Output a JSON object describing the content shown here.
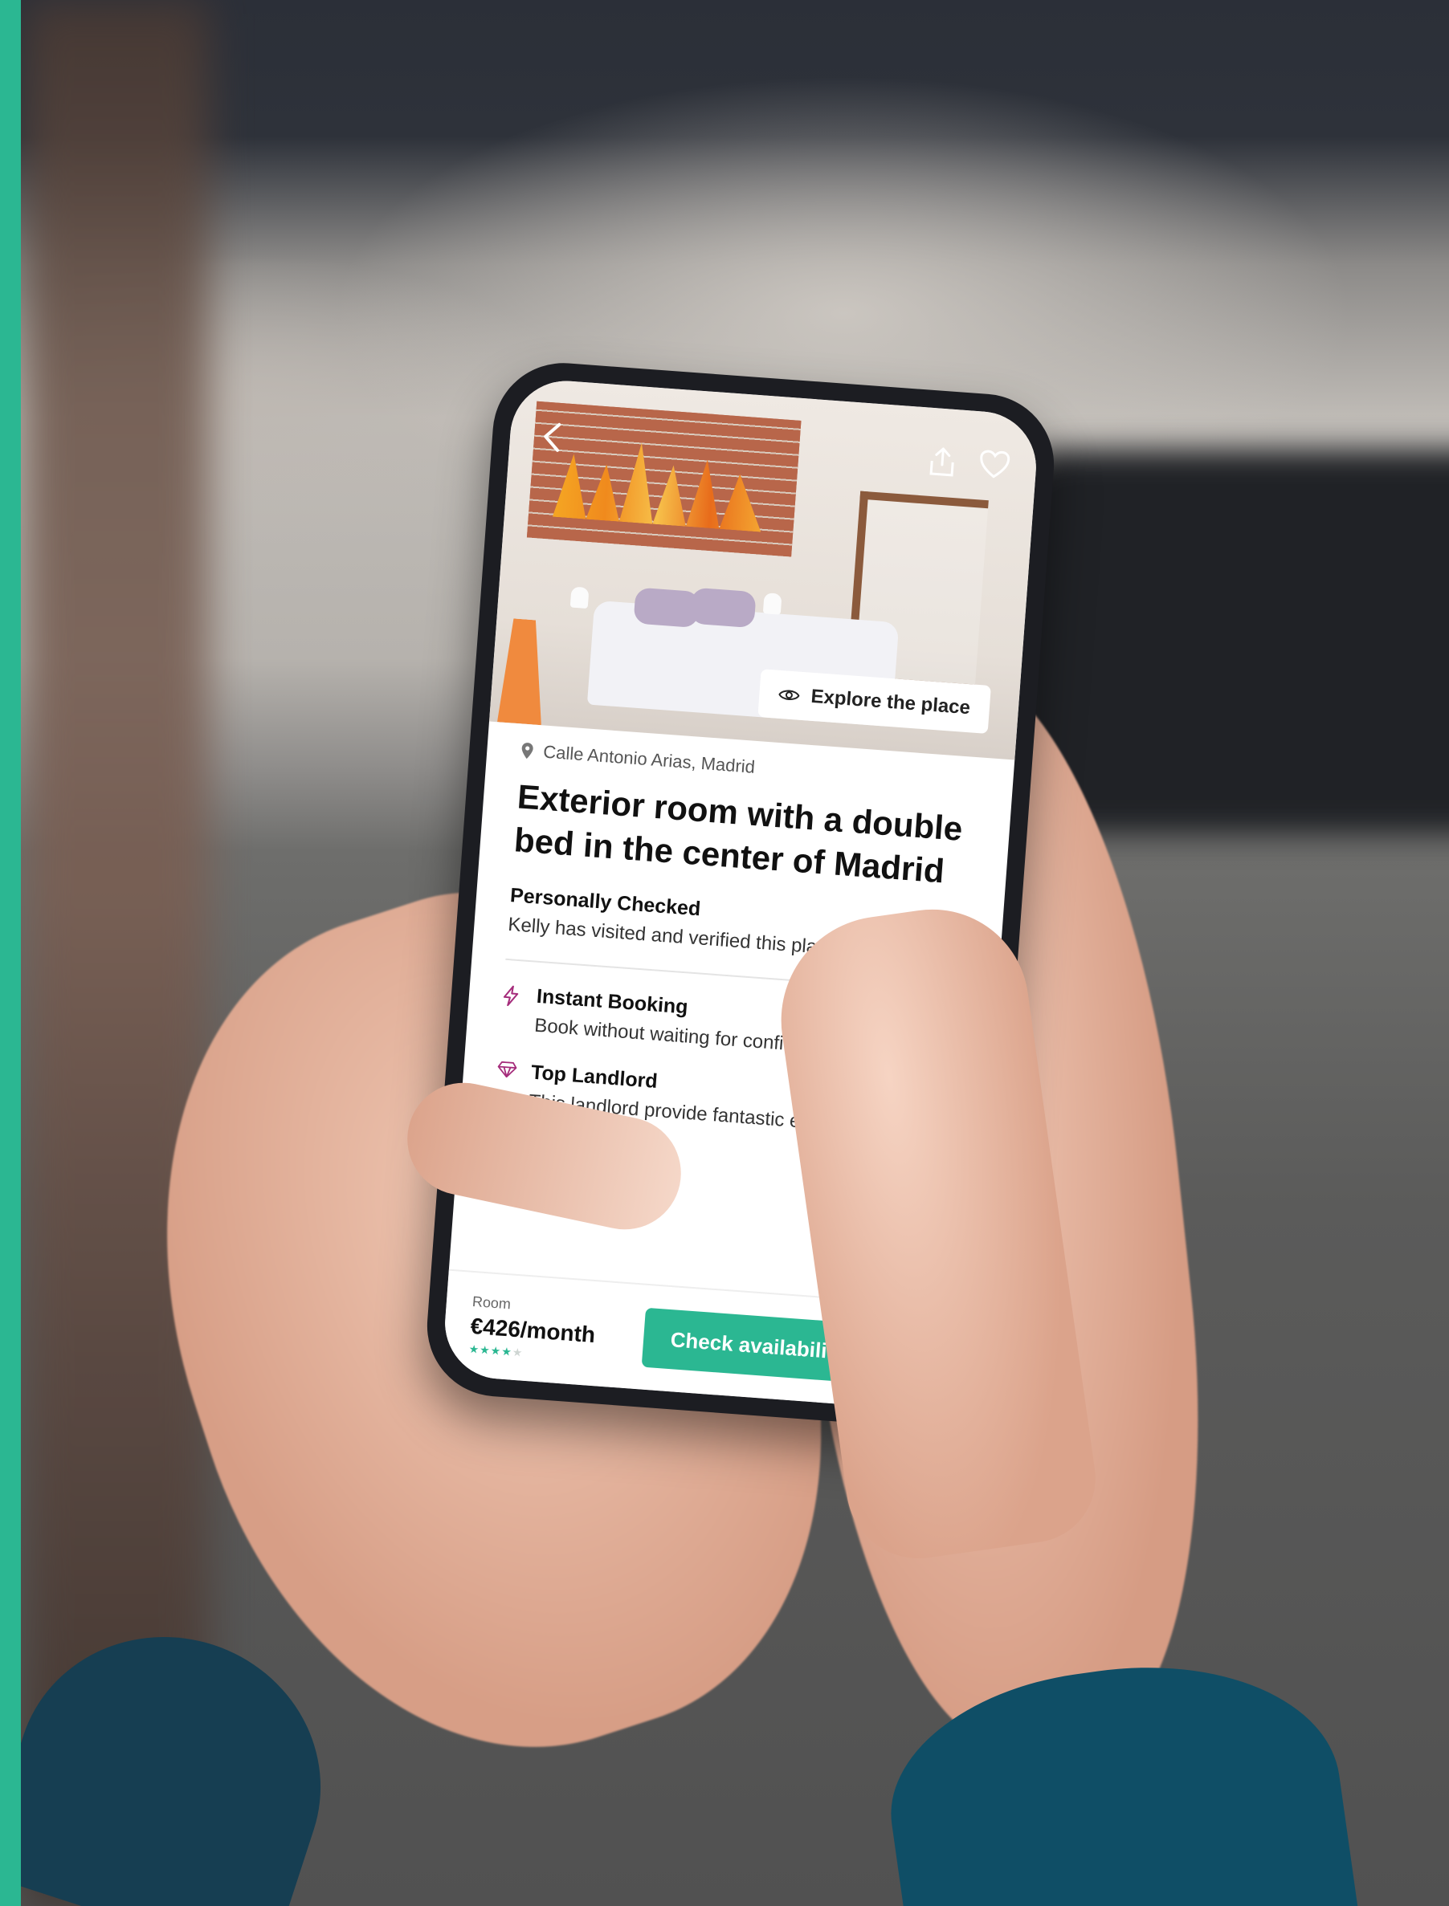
{
  "colors": {
    "accent": "#2bb792",
    "pin_icon": "#777777",
    "diamond_icon": "#a52c7b"
  },
  "listing": {
    "explore_label": "Explore the place",
    "address": "Calle Antonio Arias, Madrid",
    "title": "Exterior room with a double bed in the center of Madrid",
    "features": [
      {
        "icon": "checkmark-icon",
        "title": "Personally Checked",
        "description": "Kelly has visited and verified this place for you."
      },
      {
        "icon": "bolt-icon",
        "title": "Instant Booking",
        "description": "Book without waiting for confirmation."
      },
      {
        "icon": "diamond-icon",
        "title": "Top Landlord",
        "description": "This landlord provide fantastic experiences and great value."
      }
    ]
  },
  "booking": {
    "type_label": "Room",
    "price": "€426/month",
    "rating": 4,
    "rating_max": 5,
    "cta_label": "Check availability"
  }
}
